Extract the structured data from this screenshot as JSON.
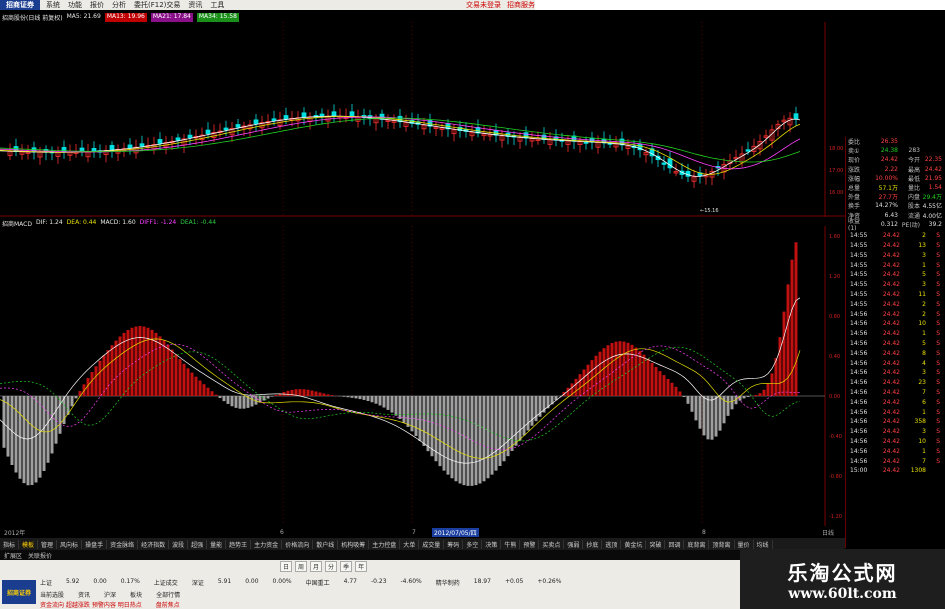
{
  "app": {
    "logo_text": "招商证券",
    "menus": [
      "系统",
      "功能",
      "报价",
      "分析",
      "委托(F12)交易",
      "资讯",
      "工具"
    ],
    "menu_right": [
      "交易未登录",
      "招商服务"
    ],
    "window_controls": [
      "_",
      "□",
      "×"
    ]
  },
  "main_chart": {
    "ma_row": [
      {
        "text": "招商股份(日线 前复权)",
        "cls": "c-white"
      },
      {
        "text": "MA5: 21.69",
        "cls": "c-white"
      },
      {
        "text": "MA13: 19.96",
        "cls": "c-bgred"
      },
      {
        "text": "MA21: 17.84",
        "cls": "c-bgmag"
      },
      {
        "text": "MA34: 15.58",
        "cls": "c-bggreen"
      }
    ],
    "price_axis": [
      "18.00",
      "17.00",
      "16.00"
    ],
    "low_label": "15.16"
  },
  "macd": {
    "row": [
      {
        "text": "招商MACD",
        "cls": "c-white"
      },
      {
        "text": "DIF: 1.24",
        "cls": "c-white"
      },
      {
        "text": "DEA: 0.44",
        "cls": "c-yellow"
      },
      {
        "text": "MACD: 1.60",
        "cls": "c-white"
      },
      {
        "text": "DIFF1: -1.24",
        "cls": "c-magenta"
      },
      {
        "text": "DEA1: -0.44",
        "cls": "c-green"
      }
    ],
    "axis": [
      "1.60",
      "1.20",
      "0.80",
      "0.40",
      "0.00",
      "-0.40",
      "-0.80",
      "-1.20"
    ]
  },
  "quote_panel": {
    "rows": [
      {
        "l": "委比",
        "v": "26.35",
        "vc": "red",
        "l2": "",
        "v2": "",
        "v2c": "red"
      },
      {
        "l": "卖①",
        "v": "24.38",
        "vc": "grn",
        "l2": "283",
        "v2": "",
        "v2c": "ylw"
      },
      {
        "l": "现价",
        "v": "24.42",
        "vc": "red",
        "l2": "今开",
        "v2": "22.35",
        "v2c": "red"
      },
      {
        "l": "涨跌",
        "v": "2.22",
        "vc": "red",
        "l2": "最高",
        "v2": "24.42",
        "v2c": "red"
      },
      {
        "l": "涨幅",
        "v": "10.00%",
        "vc": "red",
        "l2": "最低",
        "v2": "21.95",
        "v2c": "red"
      },
      {
        "l": "总量",
        "v": "57.1万",
        "vc": "ylw",
        "l2": "量比",
        "v2": "1.54",
        "v2c": "red"
      },
      {
        "l": "外盘",
        "v": "27.7万",
        "vc": "red",
        "l2": "内盘",
        "v2": "29.4万",
        "v2c": "grn"
      },
      {
        "l": "换手",
        "v": "14.27%",
        "vc": "wht",
        "l2": "股本",
        "v2": "4.55亿",
        "v2c": "wht"
      },
      {
        "l": "净资",
        "v": "6.43",
        "vc": "wht",
        "l2": "流通",
        "v2": "4.00亿",
        "v2c": "wht"
      },
      {
        "l": "收益(1)",
        "v": "0.312",
        "vc": "wht",
        "l2": "PE(动)",
        "v2": "39.2",
        "v2c": "wht"
      }
    ],
    "ticks": [
      {
        "t": "14:55",
        "p": "24.42",
        "v": "2",
        "s": "S"
      },
      {
        "t": "14:55",
        "p": "24.42",
        "v": "13",
        "s": "S"
      },
      {
        "t": "14:55",
        "p": "24.42",
        "v": "3",
        "s": "S"
      },
      {
        "t": "14:55",
        "p": "24.42",
        "v": "1",
        "s": "S"
      },
      {
        "t": "14:55",
        "p": "24.42",
        "v": "5",
        "s": "S"
      },
      {
        "t": "14:55",
        "p": "24.42",
        "v": "3",
        "s": "S"
      },
      {
        "t": "14:55",
        "p": "24.42",
        "v": "11",
        "s": "S"
      },
      {
        "t": "14:55",
        "p": "24.42",
        "v": "2",
        "s": "S"
      },
      {
        "t": "14:56",
        "p": "24.42",
        "v": "2",
        "s": "S"
      },
      {
        "t": "14:56",
        "p": "24.42",
        "v": "10",
        "s": "S"
      },
      {
        "t": "14:56",
        "p": "24.42",
        "v": "1",
        "s": "S"
      },
      {
        "t": "14:56",
        "p": "24.42",
        "v": "5",
        "s": "S"
      },
      {
        "t": "14:56",
        "p": "24.42",
        "v": "8",
        "s": "S"
      },
      {
        "t": "14:56",
        "p": "24.42",
        "v": "4",
        "s": "S"
      },
      {
        "t": "14:56",
        "p": "24.42",
        "v": "3",
        "s": "S"
      },
      {
        "t": "14:56",
        "p": "24.42",
        "v": "23",
        "s": "S"
      },
      {
        "t": "14:56",
        "p": "24.42",
        "v": "7",
        "s": "S"
      },
      {
        "t": "14:56",
        "p": "24.42",
        "v": "6",
        "s": "S"
      },
      {
        "t": "14:56",
        "p": "24.42",
        "v": "1",
        "s": "S"
      },
      {
        "t": "14:56",
        "p": "24.42",
        "v": "358",
        "s": "S"
      },
      {
        "t": "14:56",
        "p": "24.42",
        "v": "3",
        "s": "S"
      },
      {
        "t": "14:56",
        "p": "24.42",
        "v": "10",
        "s": "S"
      },
      {
        "t": "14:56",
        "p": "24.42",
        "v": "1",
        "s": "S"
      },
      {
        "t": "14:56",
        "p": "24.42",
        "v": "7",
        "s": "S"
      },
      {
        "t": "15:00",
        "p": "24.42",
        "v": "1308",
        "s": ""
      }
    ]
  },
  "datebar": {
    "left": "2012年",
    "m1": "6",
    "m2": "7",
    "selected": "2012/07/05/四",
    "m3": "8",
    "right": "日线"
  },
  "indicator_tabs": [
    "指标",
    "模板",
    "管理",
    "风向标",
    "操盘手",
    "资金脉络",
    "经济指数",
    "波段",
    "超强",
    "量能",
    "趋势王",
    "主力资金",
    "价格流向",
    "散户线",
    "机构吸筹",
    "主力控盘",
    "大单",
    "成交量",
    "筹码",
    "多空",
    "决策",
    "牛熊",
    "预警",
    "买卖点",
    "强弱",
    "抄底",
    "逃顶",
    "黄金坑",
    "突破",
    "回调",
    "底背离",
    "顶背离",
    "量价",
    "均线"
  ],
  "sub_tabs": [
    "扩展区",
    "关联报价"
  ],
  "periodbar": [
    "日",
    "周",
    "月",
    "分",
    "季",
    "年"
  ],
  "status": {
    "line1": [
      "上证",
      "5.92",
      "0.00",
      "0.17%",
      "上证成交",
      "深证",
      "5.91",
      "0.00",
      "0.00%",
      "中国重工",
      "4.77",
      "-0.23",
      "-4.60%",
      "精华制药",
      "18.97",
      "+0.05",
      "+0.26%"
    ],
    "line2": [
      "当前选股",
      "资讯",
      "沪深",
      "板块",
      "全部行情"
    ],
    "line3": [
      "资金流向 超越涨跌 预警内容 明日热点",
      "盘前焦点"
    ]
  },
  "watermark": {
    "title": "乐淘公式网",
    "url": "www.60lt.com"
  }
}
